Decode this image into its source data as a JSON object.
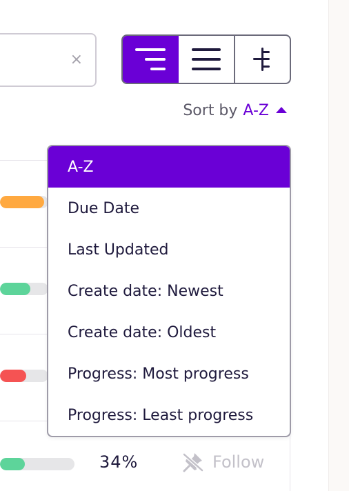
{
  "search": {
    "clear_label": "×"
  },
  "view_toggle": {
    "buttons": [
      {
        "name": "tree-list-view",
        "active": true
      },
      {
        "name": "list-view",
        "active": false
      },
      {
        "name": "hierarchy-view",
        "active": false
      }
    ]
  },
  "sort": {
    "label": "Sort by",
    "value": "A-Z"
  },
  "dropdown": {
    "items": [
      {
        "label": "A-Z",
        "selected": true
      },
      {
        "label": "Due Date"
      },
      {
        "label": "Last Updated"
      },
      {
        "label": "Create date: Newest"
      },
      {
        "label": "Create date: Oldest"
      },
      {
        "label": "Progress: Most progress"
      },
      {
        "label": "Progress: Least progress"
      }
    ]
  },
  "rows": [
    {
      "color": "#ffa940"
    },
    {
      "color": "#5dd49a"
    },
    {
      "color": "#f55353"
    },
    {
      "color": "#5dd49a",
      "progress": 0.34
    }
  ],
  "bottom_row": {
    "percent": "34%",
    "follow_label": "Follow"
  },
  "colors": {
    "accent": "#6a00d6",
    "text": "#1f1a3d"
  }
}
